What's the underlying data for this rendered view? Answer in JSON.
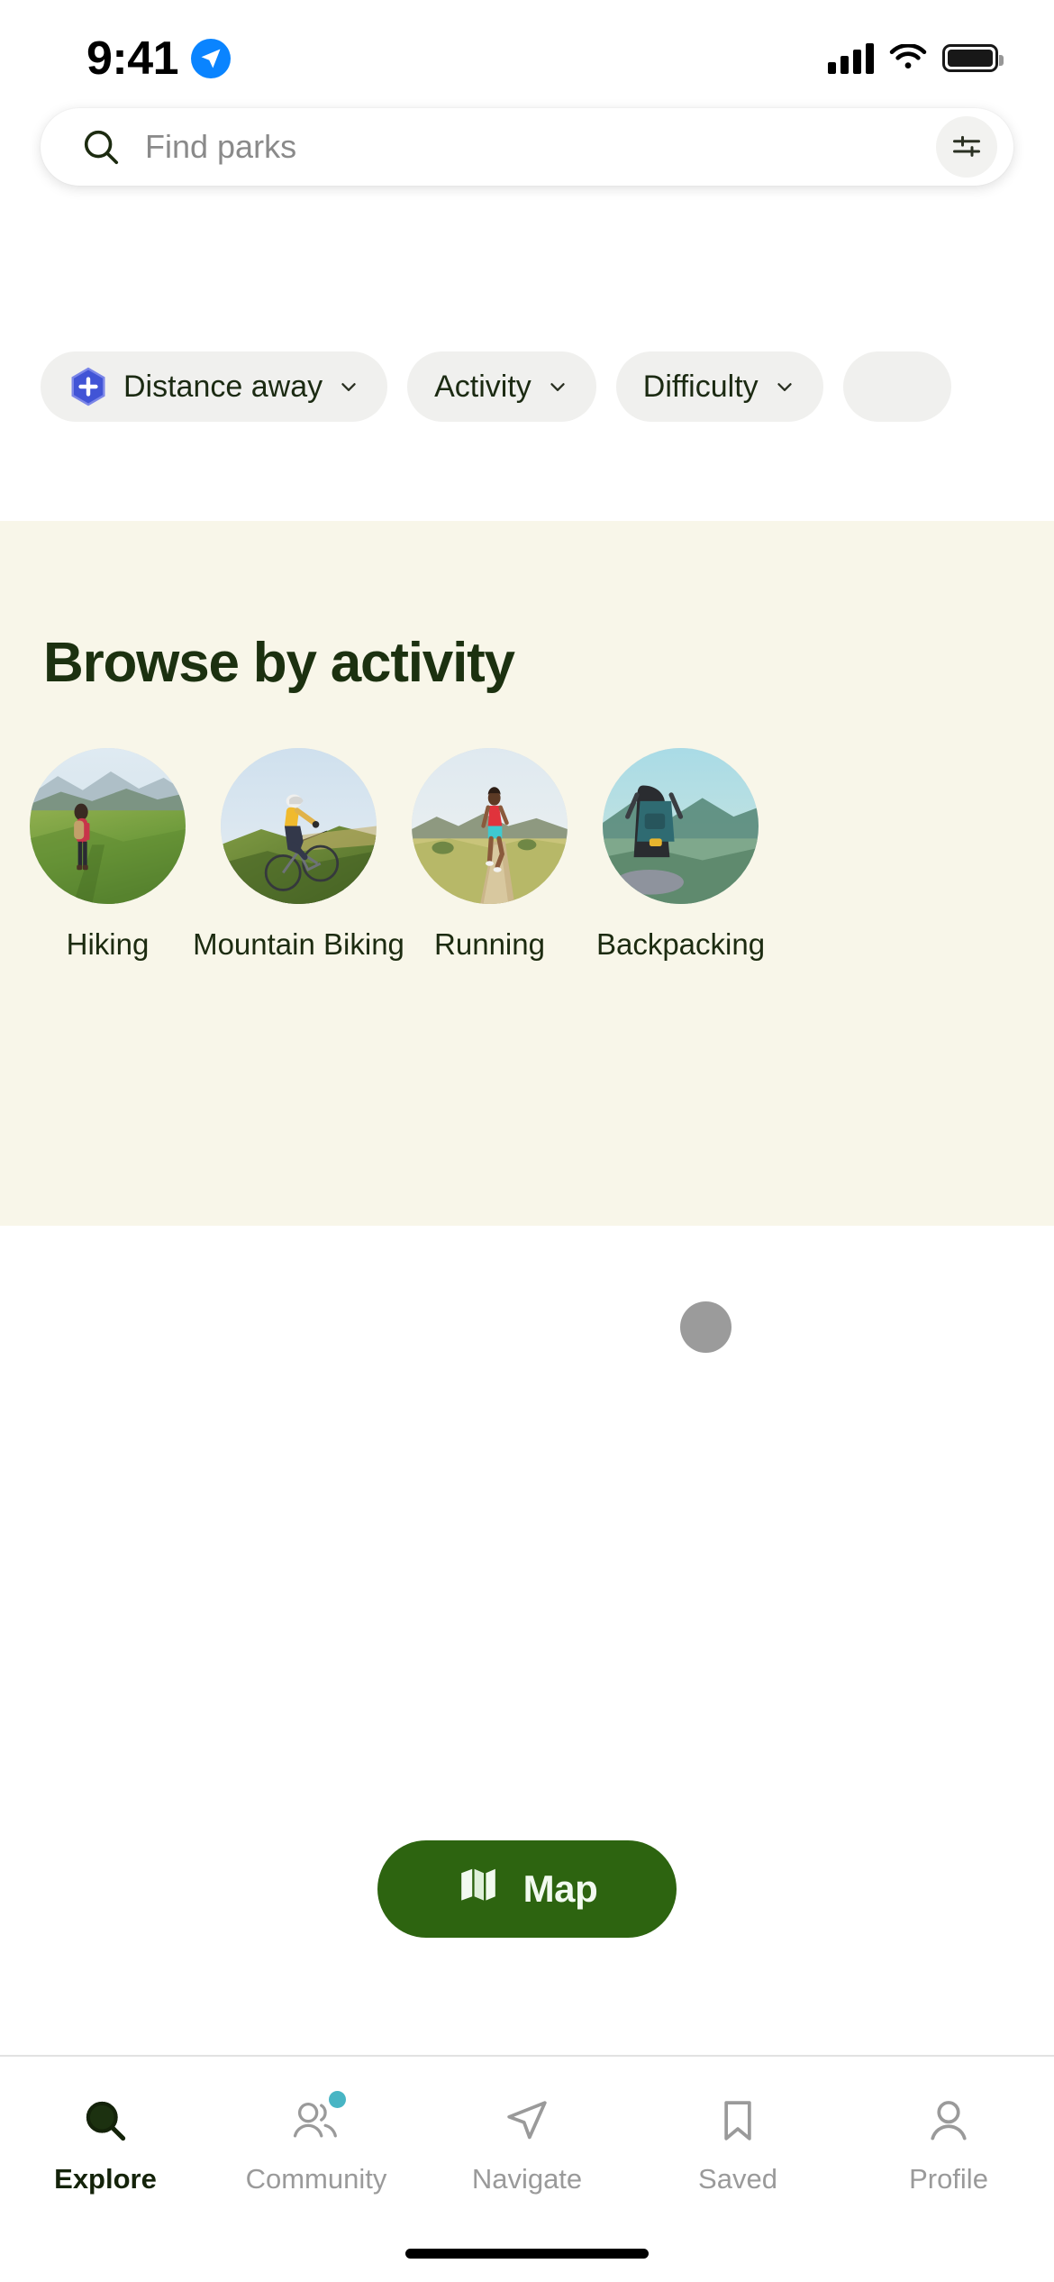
{
  "status_bar": {
    "time": "9:41",
    "location_icon": "location-arrow-icon",
    "cellular_icon": "cellular-signal-icon",
    "wifi_icon": "wifi-icon",
    "battery_icon": "battery-full-icon"
  },
  "search": {
    "placeholder": "Find parks",
    "value": "",
    "search_icon": "search-icon",
    "filter_icon": "sliders-filter-icon"
  },
  "filters": {
    "chips": [
      {
        "label": "Distance away",
        "icon": "hexagon-plus-badge-icon",
        "has_badge": true,
        "has_chevron": true
      },
      {
        "label": "Activity",
        "has_badge": false,
        "has_chevron": true
      },
      {
        "label": "Difficulty",
        "has_badge": false,
        "has_chevron": true
      },
      {
        "label": "",
        "has_badge": false,
        "has_chevron": false
      }
    ],
    "chevron_icon": "chevron-down-icon"
  },
  "browse": {
    "title": "Browse by activity",
    "background_color": "#f8f6e9",
    "title_color": "#1c3110",
    "activities": [
      {
        "label": "Hiking",
        "image": "hiker-in-green-meadow"
      },
      {
        "label": "Mountain Biking",
        "image": "cyclist-on-hillside-trail"
      },
      {
        "label": "Running",
        "image": "runner-on-dirt-path"
      },
      {
        "label": "Backpacking",
        "image": "backpacker-with-pack"
      }
    ]
  },
  "loading": {
    "indicator": "loading-dot",
    "color": "#9b9b9b"
  },
  "map_button": {
    "label": "Map",
    "icon": "map-folded-icon",
    "background_color": "#2d6410",
    "text_color": "#f2faf0"
  },
  "tab_bar": {
    "active": "Explore",
    "items": [
      {
        "label": "Explore",
        "icon": "search-magnifier-filled-icon",
        "active": true,
        "badge": false
      },
      {
        "label": "Community",
        "icon": "two-people-icon",
        "active": false,
        "badge": true
      },
      {
        "label": "Navigate",
        "icon": "paper-plane-icon",
        "active": false,
        "badge": false
      },
      {
        "label": "Saved",
        "icon": "bookmark-icon",
        "active": false,
        "badge": false
      },
      {
        "label": "Profile",
        "icon": "person-icon",
        "active": false,
        "badge": false
      }
    ],
    "badge_color": "#48b5c4",
    "active_color": "#14230a",
    "inactive_color": "#9a9a9a"
  }
}
